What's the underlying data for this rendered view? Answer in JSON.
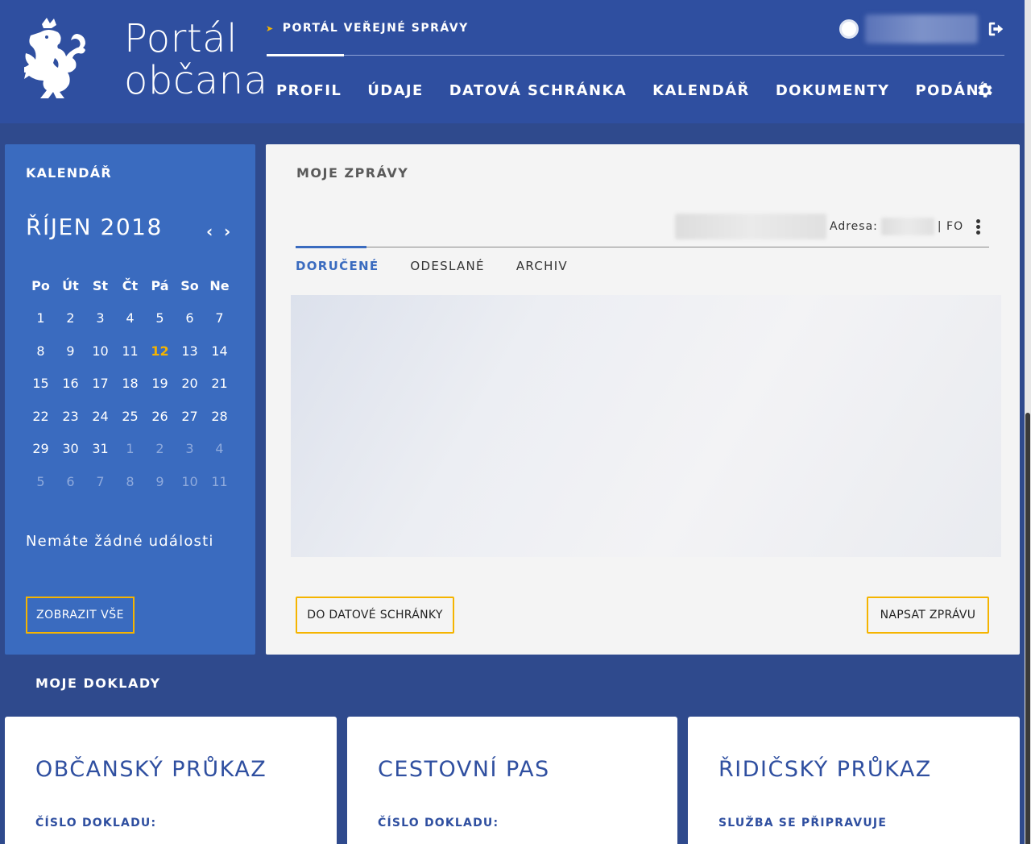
{
  "header": {
    "logo_line1": "Portál",
    "logo_line2": "občana",
    "top_link": "PORTÁL VEŘEJNÉ SPRÁVY",
    "nav": [
      "PROFIL",
      "ÚDAJE",
      "DATOVÁ SCHRÁNKA",
      "KALENDÁŘ",
      "DOKUMENTY",
      "PODÁNÍ"
    ]
  },
  "calendar": {
    "title": "KALENDÁŘ",
    "month": "ŘÍJEN 2018",
    "weekdays": [
      "Po",
      "Út",
      "St",
      "Čt",
      "Pá",
      "So",
      "Ne"
    ],
    "today": 12,
    "weeks": [
      [
        "1",
        "2",
        "3",
        "4",
        "5",
        "6",
        "7"
      ],
      [
        "8",
        "9",
        "10",
        "11",
        "12",
        "13",
        "14"
      ],
      [
        "15",
        "16",
        "17",
        "18",
        "19",
        "20",
        "21"
      ],
      [
        "22",
        "23",
        "24",
        "25",
        "26",
        "27",
        "28"
      ],
      [
        "29",
        "30",
        "31",
        "1",
        "2",
        "3",
        "4"
      ],
      [
        "5",
        "6",
        "7",
        "8",
        "9",
        "10",
        "11"
      ]
    ],
    "empty_text": "Nemáte žádné události",
    "show_all": "ZOBRAZIT VŠE"
  },
  "messages": {
    "title": "MOJE ZPRÁVY",
    "address_label": "Adresa:",
    "type_label": "| FO",
    "tabs": [
      "DORUČENÉ",
      "ODESLANÉ",
      "ARCHIV"
    ],
    "active_tab": 0,
    "btn_mailbox": "DO DATOVÉ SCHRÁNKY",
    "btn_write": "NAPSAT ZPRÁVU"
  },
  "documents": {
    "title": "MOJE DOKLADY",
    "cards": [
      {
        "name": "OBČANSKÝ PRŮKAZ",
        "label": "ČÍSLO DOKLADU:"
      },
      {
        "name": "CESTOVNÍ PAS",
        "label": "ČÍSLO DOKLADU:"
      },
      {
        "name": "ŘIDIČSKÝ PRŮKAZ",
        "label": "SLUŽBA SE PŘIPRAVUJE"
      }
    ]
  },
  "colors": {
    "header_bg": "#2f4fa0",
    "page_bg": "#2f4a8d",
    "calendar_bg": "#3a6bbf",
    "accent": "#f5b400"
  },
  "icons": [
    "lion-logo-icon",
    "arrow-right-icon",
    "avatar-icon",
    "logout-icon",
    "gear-icon",
    "chevron-left-icon",
    "chevron-right-icon",
    "more-vertical-icon"
  ]
}
